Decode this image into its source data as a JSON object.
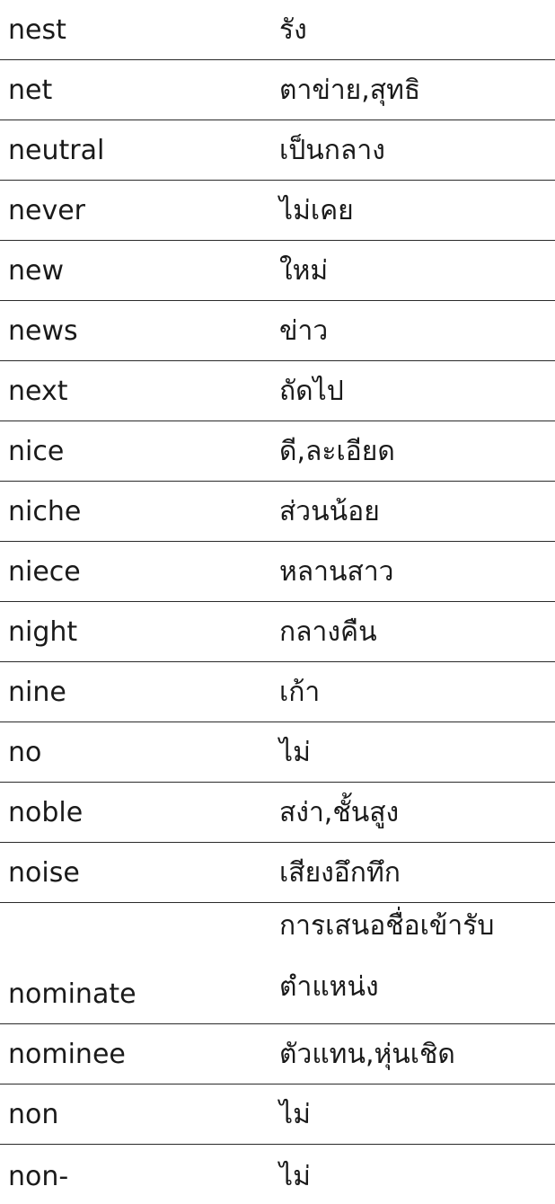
{
  "rows": [
    {
      "word": "nest",
      "meaning": "รัง"
    },
    {
      "word": "net",
      "meaning": "ตาข่าย,สุทธิ"
    },
    {
      "word": "neutral",
      "meaning": "เป็นกลาง"
    },
    {
      "word": "never",
      "meaning": "ไม่เคย"
    },
    {
      "word": "new",
      "meaning": "ใหม่"
    },
    {
      "word": "news",
      "meaning": "ข่าว"
    },
    {
      "word": "next",
      "meaning": "ถัดไป"
    },
    {
      "word": "nice",
      "meaning": "ดี,ละเอียด"
    },
    {
      "word": "niche",
      "meaning": "ส่วนน้อย"
    },
    {
      "word": "niece",
      "meaning": "หลานสาว"
    },
    {
      "word": "night",
      "meaning": "กลางคืน"
    },
    {
      "word": "nine",
      "meaning": "เก้า"
    },
    {
      "word": "no",
      "meaning": "ไม่"
    },
    {
      "word": "noble",
      "meaning": "สง่า,ชั้นสูง"
    },
    {
      "word": "noise",
      "meaning": "เสียงอึกทึก"
    },
    {
      "word": "nominate",
      "meaning": "การเสนอชื่อเข้ารับตำแหน่ง"
    },
    {
      "word": "nominee",
      "meaning": "ตัวแทน,หุ่นเชิด"
    },
    {
      "word": "non",
      "meaning": "ไม่"
    },
    {
      "word": "non-",
      "meaning": "ไม่"
    }
  ]
}
